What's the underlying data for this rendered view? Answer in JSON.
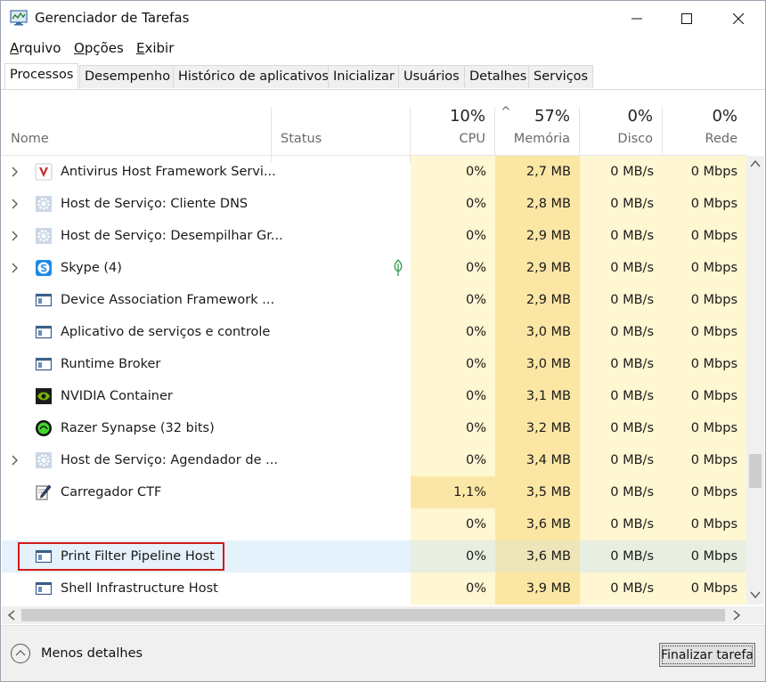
{
  "window": {
    "title": "Gerenciador de Tarefas"
  },
  "menu": [
    "Arquivo",
    "Opções",
    "Exibir"
  ],
  "tabs": [
    "Processos",
    "Desempenho",
    "Histórico de aplicativos",
    "Inicializar",
    "Usuários",
    "Detalhes",
    "Serviços"
  ],
  "active_tab": "Processos",
  "columns": {
    "name": "Nome",
    "status": "Status",
    "cpu": {
      "percent": "10%",
      "label": "CPU"
    },
    "memory": {
      "percent": "57%",
      "label": "Memória",
      "sort_indicator": "^"
    },
    "disk": {
      "percent": "0%",
      "label": "Disco"
    },
    "network": {
      "percent": "0%",
      "label": "Rede"
    }
  },
  "processes": [
    {
      "name": "Antivirus Host Framework Servi...",
      "icon": "shield-icon",
      "expandable": true,
      "status": "",
      "cpu": "0%",
      "memory": "2,7 MB",
      "disk": "0 MB/s",
      "network": "0 Mbps"
    },
    {
      "name": "Host de Serviço: Cliente DNS",
      "icon": "gear-icon",
      "expandable": true,
      "status": "",
      "cpu": "0%",
      "memory": "2,8 MB",
      "disk": "0 MB/s",
      "network": "0 Mbps"
    },
    {
      "name": "Host de Serviço: Desempilhar Gr...",
      "icon": "gear-icon",
      "expandable": true,
      "status": "",
      "cpu": "0%",
      "memory": "2,9 MB",
      "disk": "0 MB/s",
      "network": "0 Mbps"
    },
    {
      "name": "Skype (4)",
      "icon": "skype-icon",
      "expandable": true,
      "status": "suspended-leaf",
      "cpu": "0%",
      "memory": "2,9 MB",
      "disk": "0 MB/s",
      "network": "0 Mbps"
    },
    {
      "name": "Device Association Framework ...",
      "icon": "window-app-icon",
      "expandable": false,
      "status": "",
      "cpu": "0%",
      "memory": "2,9 MB",
      "disk": "0 MB/s",
      "network": "0 Mbps"
    },
    {
      "name": "Aplicativo de serviços e controle",
      "icon": "window-app-icon",
      "expandable": false,
      "status": "",
      "cpu": "0%",
      "memory": "3,0 MB",
      "disk": "0 MB/s",
      "network": "0 Mbps"
    },
    {
      "name": "Runtime Broker",
      "icon": "window-app-icon",
      "expandable": false,
      "status": "",
      "cpu": "0%",
      "memory": "3,0 MB",
      "disk": "0 MB/s",
      "network": "0 Mbps"
    },
    {
      "name": "NVIDIA Container",
      "icon": "nvidia-icon",
      "expandable": false,
      "status": "",
      "cpu": "0%",
      "memory": "3,1 MB",
      "disk": "0 MB/s",
      "network": "0 Mbps"
    },
    {
      "name": "Razer Synapse (32 bits)",
      "icon": "razer-icon",
      "expandable": false,
      "status": "",
      "cpu": "0%",
      "memory": "3,2 MB",
      "disk": "0 MB/s",
      "network": "0 Mbps"
    },
    {
      "name": "Host de Serviço: Agendador de ...",
      "icon": "gear-icon",
      "expandable": true,
      "status": "",
      "cpu": "0%",
      "memory": "3,4 MB",
      "disk": "0 MB/s",
      "network": "0 Mbps"
    },
    {
      "name": "Carregador CTF",
      "icon": "ctf-pen-icon",
      "expandable": false,
      "status": "",
      "cpu": "1,1%",
      "memory": "3,5 MB",
      "disk": "0 MB/s",
      "network": "0 Mbps"
    },
    {
      "name": "",
      "icon": "",
      "expandable": false,
      "status": "",
      "cpu": "0%",
      "memory": "3,6 MB",
      "disk": "0 MB/s",
      "network": "0 Mbps"
    },
    {
      "name": "Print Filter Pipeline Host",
      "icon": "window-app-icon",
      "expandable": false,
      "status": "",
      "cpu": "0%",
      "memory": "3,6 MB",
      "disk": "0 MB/s",
      "network": "0 Mbps",
      "hovered": true
    },
    {
      "name": "Shell Infrastructure Host",
      "icon": "window-app-icon",
      "expandable": false,
      "status": "",
      "cpu": "0%",
      "memory": "3,9 MB",
      "disk": "0 MB/s",
      "network": "0 Mbps"
    }
  ],
  "footer": {
    "less_details": "Menos detalhes",
    "end_task": "Finalizar tarefa"
  },
  "colors": {
    "cpu_heat_light": "#fff6d2",
    "memory_heat": "#fbe6a4",
    "hover_row": "#e5f1fb",
    "highlight_border": "#d11a1a"
  }
}
